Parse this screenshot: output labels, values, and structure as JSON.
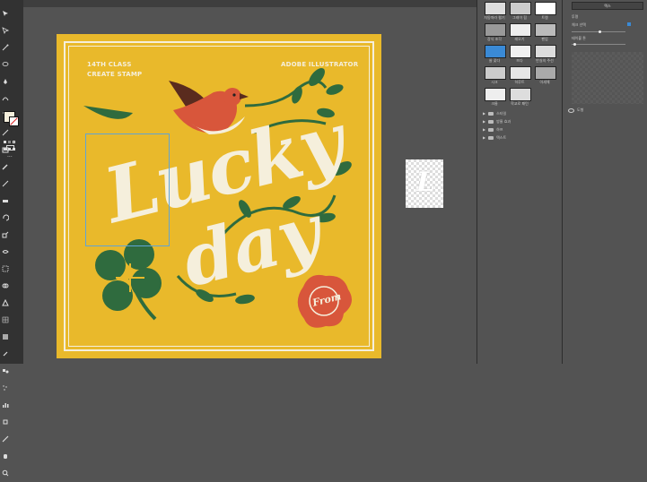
{
  "artwork": {
    "top_left_line1": "14TH CLASS",
    "top_left_line2": "CREATE STAMP",
    "top_right": "ADOBE ILLUSTRATOR",
    "word1": "Lucky",
    "word2": "day",
    "badge": "From",
    "colors": {
      "background": "#e9b92b",
      "cream": "#f5efdc",
      "green": "#2f6b3e",
      "red": "#d8563b"
    }
  },
  "thumbnail": {
    "letter": "L"
  },
  "swatch_panel": {
    "labels": [
      "자동따라 펼기",
      "그레이 힘",
      "트렘",
      "장식 조각",
      "레오기",
      "펜업",
      "쓸 꽂다",
      "뜨다",
      "반실의 주선",
      "시크",
      "하루트",
      "아세해",
      "크롬",
      "학교로 패턴",
      ""
    ],
    "folders": [
      "스타일",
      "방울 효과",
      "하프",
      "텍스트"
    ]
  },
  "right_panel": {
    "header": "텍스",
    "section1": "투명",
    "option1": "체크 선택",
    "option2": "테이블 톤",
    "layer_label": "도형"
  }
}
